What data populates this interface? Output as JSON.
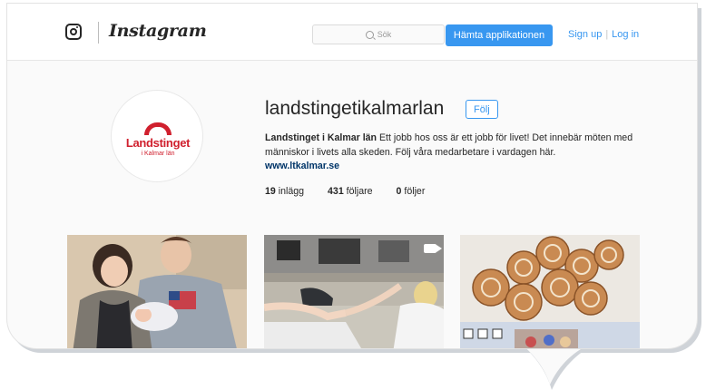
{
  "header": {
    "brand_name": "Instagram",
    "search_placeholder": "Sök",
    "get_app_label": "Hämta applikationen",
    "signup_label": "Sign up",
    "separator": "|",
    "login_label": "Log in",
    "accent_color": "#3897f0"
  },
  "profile": {
    "avatar_logo_text": "Landstinget",
    "avatar_logo_subtext": "i Kalmar län",
    "username": "landstingetikalmarlan",
    "follow_label": "Följ",
    "full_name": "Landstinget i Kalmar län",
    "bio": " Ett jobb hos oss är ett jobb för livet! Det innebär möten med människor i livets alla skeden. Följ våra medarbetare i vardagen här.",
    "website": "www.ltkalmar.se",
    "stats": {
      "posts_count": "19",
      "posts_label": "inlägg",
      "followers_count": "431",
      "followers_label": "följare",
      "following_count": "0",
      "following_label": "följer"
    },
    "brand_color": "#d0202e"
  },
  "posts": [
    {
      "type": "photo"
    },
    {
      "type": "video"
    },
    {
      "type": "photo"
    }
  ],
  "icons": [
    "instagram-glyph-icon",
    "search-icon",
    "video-icon"
  ]
}
